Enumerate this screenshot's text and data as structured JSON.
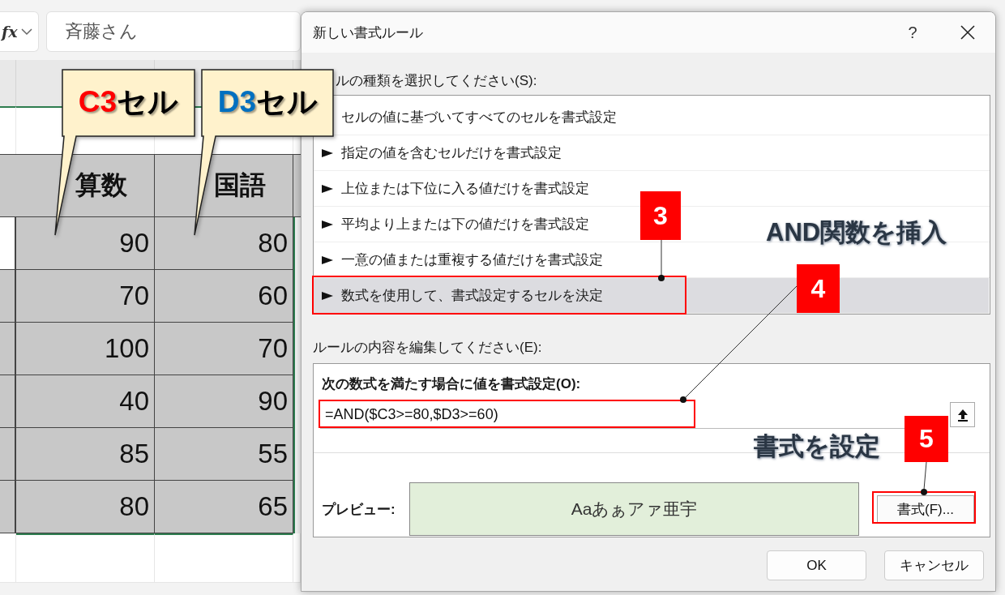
{
  "formula_bar": {
    "fx_label": "fx",
    "value": "斉藤さん"
  },
  "table": {
    "columns": [
      "算数",
      "国語"
    ],
    "rows": [
      [
        "90",
        "80"
      ],
      [
        "70",
        "60"
      ],
      [
        "100",
        "70"
      ],
      [
        "40",
        "90"
      ],
      [
        "85",
        "55"
      ],
      [
        "80",
        "65"
      ]
    ]
  },
  "dialog": {
    "title": "新しい書式ルール",
    "help": "?",
    "rule_type_label": "ルの種類を選択してください(S):",
    "rule_types": [
      {
        "label": "セルの値に基づいてすべてのセルを書式設定",
        "selected": false
      },
      {
        "label": "指定の値を含むセルだけを書式設定",
        "selected": false
      },
      {
        "label": "上位または下位に入る値だけを書式設定",
        "selected": false
      },
      {
        "label": "平均より上または下の値だけを書式設定",
        "selected": false
      },
      {
        "label": "一意の値または重複する値だけを書式設定",
        "selected": false
      },
      {
        "label": "数式を使用して、書式設定するセルを決定",
        "selected": true
      }
    ],
    "edit_label": "ルールの内容を編集してください(E):",
    "formula_label": "次の数式を満たす場合に値を書式設定(O):",
    "formula": "=AND($C3>=80,$D3>=60)",
    "preview_label": "プレビュー:",
    "preview_text": "Aaあぁアァ亜宇",
    "format_button": "書式(F)...",
    "ok_button": "OK",
    "cancel_button": "キャンセル"
  },
  "annotations": {
    "callouts": [
      {
        "ref": "C3",
        "suffix": "セル",
        "color": "#ff0000"
      },
      {
        "ref": "D3",
        "suffix": "セル",
        "color": "#0070c0"
      }
    ],
    "badges": [
      "3",
      "4",
      "5"
    ],
    "captions": [
      "AND関数を挿入",
      "書式を設定"
    ]
  }
}
